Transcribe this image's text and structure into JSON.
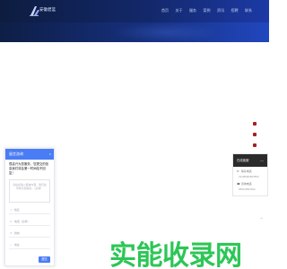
{
  "header": {
    "logo_text": "安徽碧蓝",
    "nav": [
      "首页",
      "关于",
      "服务",
      "案例",
      "资讯",
      "招聘",
      "联系"
    ]
  },
  "side_dots": 4,
  "consult": {
    "title": "留言咨询",
    "close": "×",
    "message": "很高兴为您服务，您提交的信息我们将会第一时间给予回复！",
    "textarea_placeholder": "请在此输入留言内容，我们会尽快与您联系。（必填）",
    "fields": [
      {
        "icon": "user-icon",
        "placeholder": "姓名"
      },
      {
        "icon": "phone-icon",
        "placeholder": "电话（必填）"
      },
      {
        "icon": "wechat-icon",
        "placeholder": "微信"
      },
      {
        "icon": "home-icon",
        "placeholder": "地址"
      }
    ],
    "submit": "提交"
  },
  "contact": {
    "title": "在线客服",
    "minimize": "—",
    "phone_label": "联系电话",
    "phone": "19138482827866",
    "tel_label": "咨询电话",
    "tel": "0563-6821612"
  },
  "watermark": "实能收录网"
}
